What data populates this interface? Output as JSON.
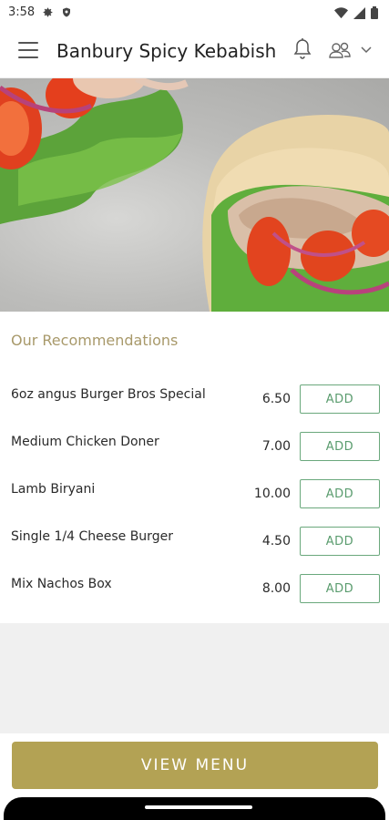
{
  "status_bar": {
    "time": "3:58",
    "left_icons": [
      "gear-icon",
      "shield-icon"
    ],
    "right_icons": [
      "wifi-icon",
      "signal-icon",
      "battery-icon"
    ]
  },
  "app_bar": {
    "title": "Banbury Spicy Kebabish",
    "icons": [
      "hamburger-menu-icon",
      "bell-icon",
      "users-icon",
      "chevron-down-icon"
    ]
  },
  "hero": {
    "image": "kebab-pita-food-photo"
  },
  "recommendations": {
    "heading": "Our Recommendations",
    "add_label": "ADD",
    "items": [
      {
        "name": "6oz angus Burger Bros Special",
        "price": "6.50"
      },
      {
        "name": "Medium Chicken Doner",
        "price": "7.00"
      },
      {
        "name": "Lamb Biryani",
        "price": "10.00"
      },
      {
        "name": "Single 1/4 Cheese Burger",
        "price": "4.50"
      },
      {
        "name": "Mix Nachos Box",
        "price": "8.00"
      }
    ]
  },
  "footer": {
    "view_menu_label": "VIEW MENU"
  },
  "colors": {
    "accent_gold": "#b3a254",
    "heading_gold": "#a8996a",
    "add_green": "#5a9c6e"
  }
}
